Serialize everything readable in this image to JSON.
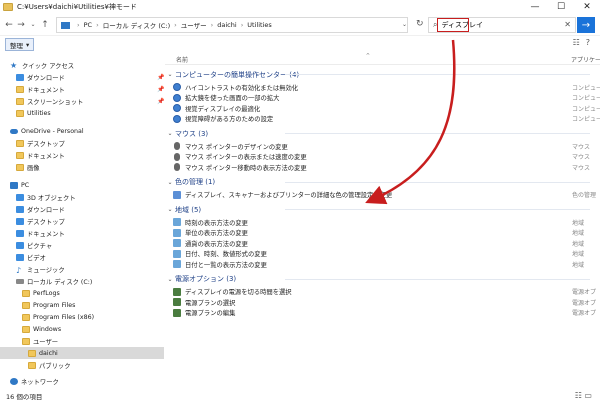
{
  "window": {
    "title": "C:¥Users¥daichi¥Utilities¥神モード",
    "minimize": "—",
    "maximize": "☐",
    "close": "✕"
  },
  "address": {
    "back": "←",
    "forward": "→",
    "recent": "⌄",
    "up": "↑",
    "crumbs": [
      "PC",
      "ローカル ディスク (C:)",
      "ユーザー",
      "daichi",
      "Utilities"
    ],
    "separator": "›",
    "dropdown": "⌄",
    "refresh": "↻"
  },
  "search": {
    "query": "ディスプレイ",
    "icon": "⌕",
    "clear": "✕",
    "go": "→"
  },
  "toolbar": {
    "organize": "整理",
    "organize_arrow": "▾",
    "view_icon": "☷",
    "help_icon": "?"
  },
  "nav": {
    "items": [
      {
        "label": "クイック アクセス",
        "icon": "star",
        "glyph": "★"
      },
      {
        "label": "ダウンロード",
        "icon": "blue",
        "pin": "📌"
      },
      {
        "label": "ドキュメント",
        "icon": "folder",
        "pin": "📌"
      },
      {
        "label": "スクリーンショット",
        "icon": "folder",
        "pin": "📌"
      },
      {
        "label": "Utilities",
        "icon": "folder"
      },
      {
        "label": "OneDrive - Personal",
        "icon": "cloud"
      },
      {
        "label": "デスクトップ",
        "icon": "folder"
      },
      {
        "label": "ドキュメント",
        "icon": "folder"
      },
      {
        "label": "画像",
        "icon": "folder"
      },
      {
        "label": "PC",
        "icon": "pc"
      },
      {
        "label": "3D オブジェクト",
        "icon": "blue"
      },
      {
        "label": "ダウンロード",
        "icon": "blue"
      },
      {
        "label": "デスクトップ",
        "icon": "blue"
      },
      {
        "label": "ドキュメント",
        "icon": "blue"
      },
      {
        "label": "ピクチャ",
        "icon": "blue"
      },
      {
        "label": "ビデオ",
        "icon": "blue"
      },
      {
        "label": "ミュージック",
        "icon": "music",
        "glyph": "♪"
      },
      {
        "label": "ローカル ディスク (C:)",
        "icon": "disk"
      },
      {
        "label": "PerfLogs",
        "icon": "folder"
      },
      {
        "label": "Program Files",
        "icon": "folder"
      },
      {
        "label": "Program Files (x86)",
        "icon": "folder"
      },
      {
        "label": "Windows",
        "icon": "folder"
      },
      {
        "label": "ユーザー",
        "icon": "folder"
      },
      {
        "label": "daichi",
        "icon": "folder"
      },
      {
        "label": "パブリック",
        "icon": "folder"
      },
      {
        "label": "ネットワーク",
        "icon": "net"
      }
    ]
  },
  "columns": {
    "name": "名前",
    "app": "アプリケーション",
    "sort_chevron": "⌃"
  },
  "groups": [
    {
      "title": "コンピューターの簡単操作センター (4)",
      "icon": "access",
      "items": [
        {
          "name": "ハイコントラストの有効化または無効化",
          "cat": "コンピューター"
        },
        {
          "name": "拡大鏡を使った画面の一部の拡大",
          "cat": "コンピューター"
        },
        {
          "name": "視覚ディスプレイの最適化",
          "cat": "コンピューター"
        },
        {
          "name": "視覚障碍がある方のための設定",
          "cat": "コンピューター"
        }
      ]
    },
    {
      "title": "マウス (3)",
      "icon": "mouse",
      "items": [
        {
          "name": "マウス ポインターのデザインの変更",
          "cat": "マウス"
        },
        {
          "name": "マウス ポインターの表示または速度の変更",
          "cat": "マウス"
        },
        {
          "name": "マウス ポインター移動時の表示方法の変更",
          "cat": "マウス"
        }
      ]
    },
    {
      "title": "色の管理 (1)",
      "icon": "color",
      "items": [
        {
          "name": "ディスプレイ、スキャナーおよびプリンターの詳細な色の管理設定の変更",
          "cat": "色の管理"
        }
      ]
    },
    {
      "title": "地域 (5)",
      "icon": "region",
      "items": [
        {
          "name": "時刻の表示方法の変更",
          "cat": "地域"
        },
        {
          "name": "単位の表示方法の変更",
          "cat": "地域"
        },
        {
          "name": "通貨の表示方法の変更",
          "cat": "地域"
        },
        {
          "name": "日付、時刻、数値形式の変更",
          "cat": "地域"
        },
        {
          "name": "日付と一覧の表示方法の変更",
          "cat": "地域"
        }
      ]
    },
    {
      "title": "電源オプション (3)",
      "icon": "power",
      "items": [
        {
          "name": "ディスプレイの電源を切る時間を選択",
          "cat": "電源オプ"
        },
        {
          "name": "電源プランの選択",
          "cat": "電源オプ"
        },
        {
          "name": "電源プランの編集",
          "cat": "電源オプ"
        }
      ]
    }
  ],
  "status": {
    "count": "16 個の項目",
    "right_icons": "☷ ▭"
  },
  "colors": {
    "annotation": "#c81e1e",
    "accent": "#1a73d9",
    "group_title": "#1d3f86"
  }
}
